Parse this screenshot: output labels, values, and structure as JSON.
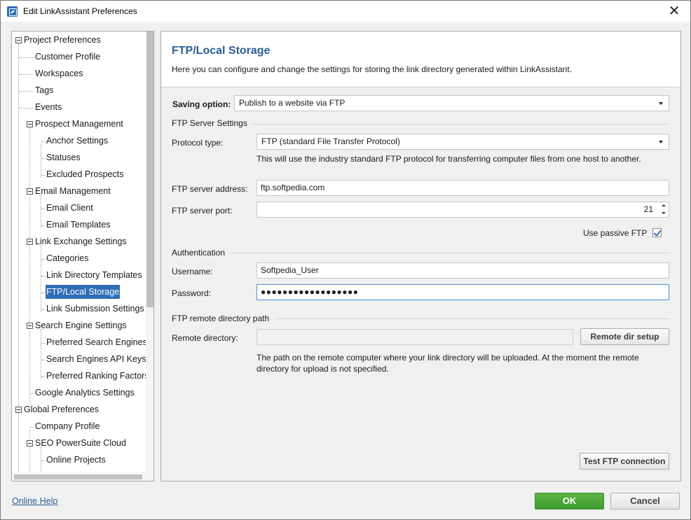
{
  "window": {
    "title": "Edit LinkAssistant Preferences",
    "close_glyph": "✕"
  },
  "tree": {
    "items": [
      {
        "label": "Project Preferences"
      },
      {
        "label": "Customer Profile"
      },
      {
        "label": "Workspaces"
      },
      {
        "label": "Tags"
      },
      {
        "label": "Events"
      },
      {
        "label": "Prospect Management"
      },
      {
        "label": "Anchor Settings"
      },
      {
        "label": "Statuses"
      },
      {
        "label": "Excluded Prospects"
      },
      {
        "label": "Email Management"
      },
      {
        "label": "Email Client"
      },
      {
        "label": "Email Templates"
      },
      {
        "label": "Link Exchange Settings"
      },
      {
        "label": "Categories"
      },
      {
        "label": "Link Directory Templates"
      },
      {
        "label": "FTP/Local Storage",
        "selected": true
      },
      {
        "label": "Link Submission Settings"
      },
      {
        "label": "Search Engine Settings"
      },
      {
        "label": "Preferred Search Engines"
      },
      {
        "label": "Search Engines API Keys"
      },
      {
        "label": "Preferred Ranking Factors"
      },
      {
        "label": "Google Analytics Settings"
      },
      {
        "label": "Global Preferences"
      },
      {
        "label": "Company Profile"
      },
      {
        "label": "SEO PowerSuite Cloud"
      },
      {
        "label": "Online Projects"
      }
    ]
  },
  "page": {
    "title": "FTP/Local Storage",
    "description": "Here you can configure and change the settings for storing the link directory generated within LinkAssistant."
  },
  "saving": {
    "label": "Saving option:",
    "value": "Publish to a website via FTP"
  },
  "ftp_server": {
    "section": "FTP Server Settings",
    "protocol_label": "Protocol type:",
    "protocol_value": "FTP (standard File Transfer Protocol)",
    "protocol_hint": "This will use the industry standard FTP protocol for transferring computer files from one host to another.",
    "address_label": "FTP server address:",
    "address_value": "ftp.softpedia.com",
    "port_label": "FTP server port:",
    "port_value": "21",
    "passive_label": "Use passive FTP",
    "passive_checked": true
  },
  "auth": {
    "section": "Authentication",
    "username_label": "Username:",
    "username_value": "Softpedia_User",
    "password_label": "Password:",
    "password_value": "●●●●●●●●●●●●●●●●●●"
  },
  "remote": {
    "section": "FTP remote directory path",
    "dir_label": "Remote directory:",
    "dir_value": "",
    "setup_button": "Remote dir setup",
    "hint_line1": "The path on the remote computer where your link directory will be uploaded. At the moment the remote",
    "hint_line2": "directory for upload is not specified."
  },
  "test_button": "Test FTP connection",
  "footer": {
    "help": "Online Help",
    "ok": "OK",
    "cancel": "Cancel"
  },
  "colors": {
    "accent": "#2a5d93",
    "ok_green": "#4aa636",
    "selection": "#2f6db8"
  }
}
